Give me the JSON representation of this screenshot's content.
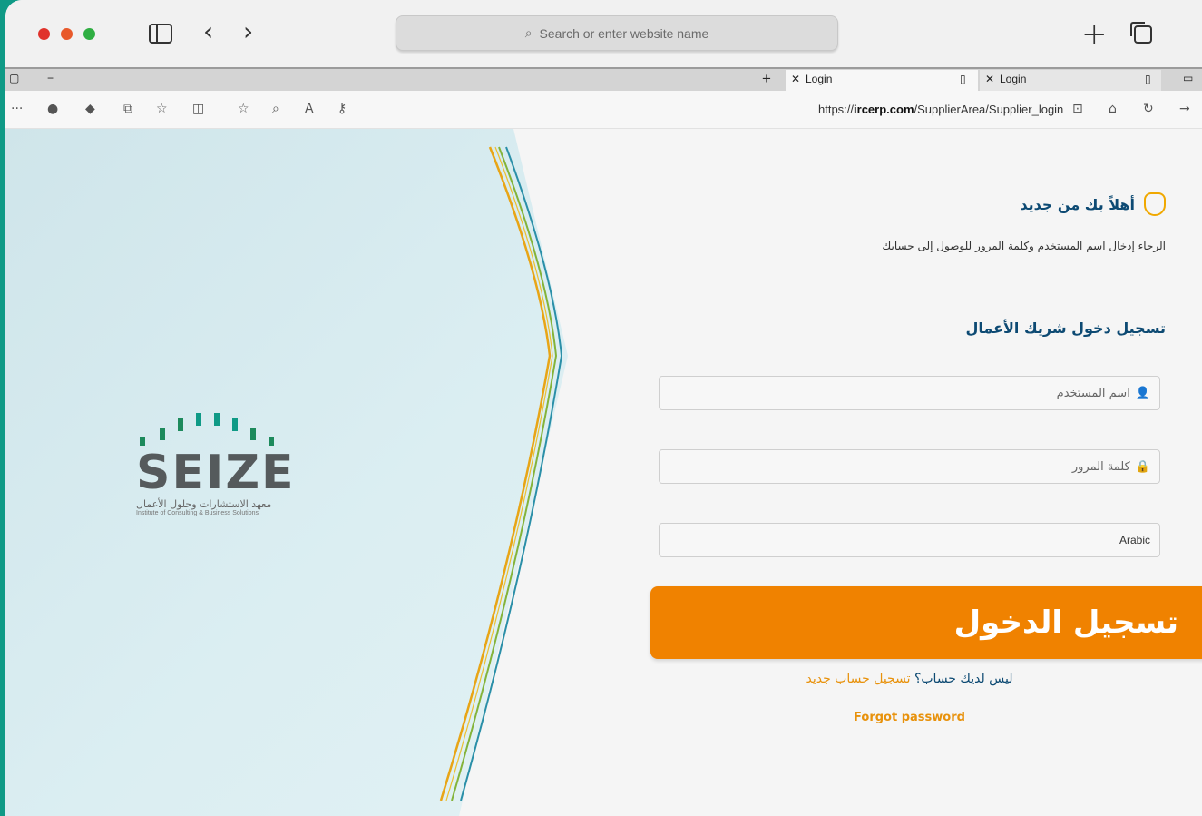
{
  "browser": {
    "address_placeholder": "Search or enter website name",
    "search_glyph": "⌕",
    "back_glyph": "‹",
    "forward_glyph": "›",
    "new_tab_glyph": "+"
  },
  "edge": {
    "tabs": [
      {
        "close": "✕",
        "label": "Login"
      },
      {
        "close": "✕",
        "label": "Login"
      }
    ],
    "minimize_glyph": "−",
    "url_prefix": "https://",
    "url_domain": "ircerp.com",
    "url_path": "/SupplierArea/Supplier_login",
    "more_glyph": "···"
  },
  "logo": {
    "word": "SEIZE",
    "arabic": "معهد الاستشارات وحلول الأعمال",
    "english": "Institute of Consulting & Business Solutions"
  },
  "login": {
    "greeting": "أهلاً بك من جديد",
    "subtitle": "الرجاء إدخال اسم المستخدم وكلمة المرور للوصول إلى حسابك",
    "section_title": "تسجيل دخول شريك الأعمال",
    "username_placeholder": "اسم المستخدم",
    "password_placeholder": "كلمة المرور",
    "language_value": "Arabic",
    "submit_label": "تسجيل الدخول",
    "no_account_text": "ليس لديك حساب؟",
    "register_link": "تسجيل حساب جديد",
    "forgot_link": "Forgot password"
  },
  "colors": {
    "accent_orange": "#f08200",
    "heading_blue": "#0d4a73",
    "brand_green": "#0f9a86"
  }
}
